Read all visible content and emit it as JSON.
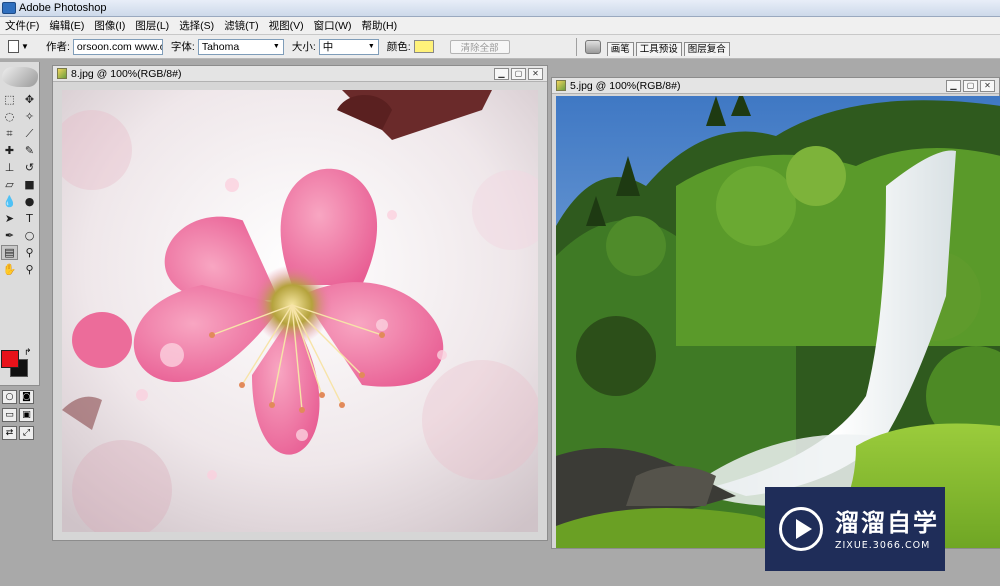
{
  "app": {
    "title": "Adobe Photoshop"
  },
  "menubar": {
    "items": [
      {
        "label": "文件(F)"
      },
      {
        "label": "编辑(E)"
      },
      {
        "label": "图像(I)"
      },
      {
        "label": "图层(L)"
      },
      {
        "label": "选择(S)"
      },
      {
        "label": "滤镜(T)"
      },
      {
        "label": "视图(V)"
      },
      {
        "label": "窗口(W)"
      },
      {
        "label": "帮助(H)"
      }
    ]
  },
  "options": {
    "author_label": "作者:",
    "author_value": "orsoon.com www.ors",
    "font_label": "字体:",
    "font_value": "Tahoma",
    "size_label": "大小:",
    "size_value": "中",
    "color_label": "颜色:",
    "color_swatch": "#fff27a",
    "clear_all_label": "清除全部",
    "palette_tabs": [
      {
        "label": "画笔"
      },
      {
        "label": "工具预设"
      },
      {
        "label": "图层复合"
      }
    ]
  },
  "toolbox": {
    "foreground_color": "#e8121a",
    "background_color": "#111111"
  },
  "documents": [
    {
      "title": "8.jpg @ 100%(RGB/8#)",
      "content": "pink-flower-photo"
    },
    {
      "title": "5.jpg @ 100%(RGB/8#)",
      "content": "waterfall-photo"
    }
  ],
  "watermark": {
    "brand": "溜溜自学",
    "url": "ZIXUE.3066.COM"
  }
}
